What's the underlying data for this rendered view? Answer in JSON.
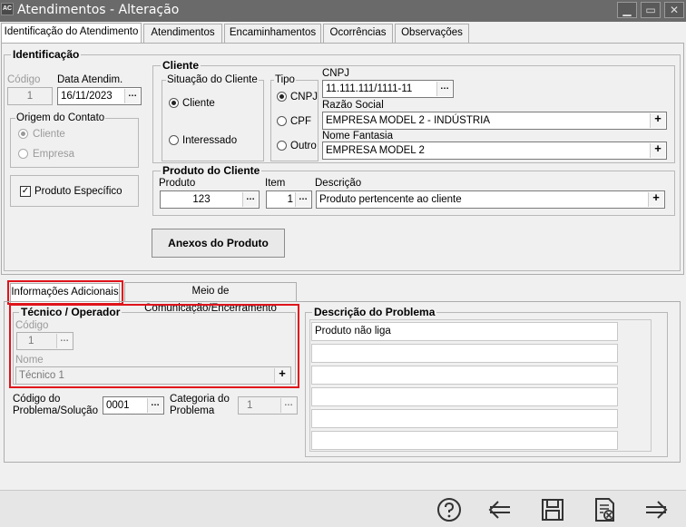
{
  "window": {
    "app_icon": "AC",
    "title": "Atendimentos - Alteração"
  },
  "top_tabs": [
    "Identificação do Atendimento",
    "Atendimentos",
    "Encaminhamentos",
    "Ocorrências",
    "Observações"
  ],
  "identificacao": {
    "legend": "Identificação",
    "codigo_label": "Código",
    "codigo_value": "1",
    "data_label": "Data Atendim.",
    "data_value": "16/11/2023",
    "origem": {
      "legend": "Origem do Contato",
      "cliente": "Cliente",
      "empresa": "Empresa"
    },
    "produto_especifico": "Produto Específico"
  },
  "cliente": {
    "legend": "Cliente",
    "situacao": {
      "legend": "Situação do Cliente",
      "cliente": "Cliente",
      "interessado": "Interessado"
    },
    "tipo": {
      "legend": "Tipo",
      "cnpj": "CNPJ",
      "cpf": "CPF",
      "outro": "Outro"
    },
    "cnpj_label": "CNPJ",
    "cnpj_value": "11.111.111/1111-11",
    "razao_label": "Razão Social",
    "razao_value": "EMPRESA MODEL 2 - INDÚSTRIA",
    "fantasia_label": "Nome Fantasia",
    "fantasia_value": "EMPRESA MODEL 2"
  },
  "produto_cliente": {
    "legend": "Produto do Cliente",
    "produto_label": "Produto",
    "produto_value": "123",
    "item_label": "Item",
    "item_value": "1",
    "descricao_label": "Descrição",
    "descricao_value": "Produto pertencente ao cliente"
  },
  "anexos_button": "Anexos do Produto",
  "bottom_tabs": [
    "Informações Adicionais",
    "Meio de Comunicação/Encerramento"
  ],
  "tecnico": {
    "legend": "Técnico / Operador",
    "codigo_label": "Código",
    "codigo_value": "1",
    "nome_label": "Nome",
    "nome_value": "Técnico 1"
  },
  "codigo_problema": {
    "label_line1": "Código do",
    "label_line2": "Problema/Solução",
    "value": "0001"
  },
  "categoria_problema": {
    "label_line1": "Categoria do",
    "label_line2": "Problema",
    "value": "1"
  },
  "descricao_problema": {
    "legend": "Descrição do Problema",
    "lines": [
      "Produto não liga",
      "",
      "",
      "",
      "",
      ""
    ]
  },
  "icons": {
    "help": "help-icon",
    "back": "back-arrow-icon",
    "save": "save-icon",
    "cancel": "cancel-document-icon",
    "next": "next-arrow-icon"
  },
  "colors": {
    "highlight": "#e0141b",
    "titlebar": "#6a6a6a"
  }
}
